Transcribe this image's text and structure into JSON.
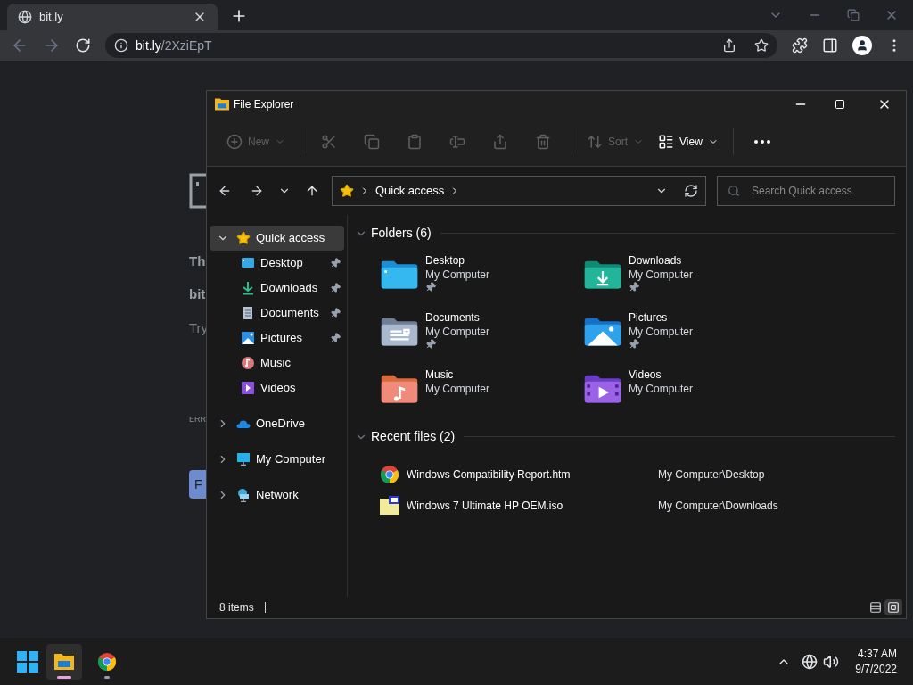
{
  "browser": {
    "tab": {
      "title": "bit.ly"
    },
    "url_host": "bit.ly",
    "url_path": "/2XziEpT"
  },
  "page_behind": {
    "heading": "Th",
    "host": "bit",
    "hint": "Try",
    "error": "ERR",
    "button": "F"
  },
  "explorer": {
    "title": "File Explorer",
    "toolbar": [
      {
        "kind": "new",
        "label": "New",
        "disabled": true
      },
      {
        "kind": "cut",
        "disabled": true
      },
      {
        "kind": "copy",
        "disabled": true
      },
      {
        "kind": "paste",
        "disabled": true
      },
      {
        "kind": "rename",
        "disabled": true
      },
      {
        "kind": "share",
        "disabled": true
      },
      {
        "kind": "delete",
        "disabled": true
      },
      {
        "kind": "sort",
        "label": "Sort",
        "disabled": true
      },
      {
        "kind": "view",
        "label": "View",
        "disabled": false
      },
      {
        "kind": "more",
        "disabled": false
      }
    ],
    "breadcrumb": "Quick access",
    "search": {
      "placeholder": "Search Quick access"
    },
    "nav": [
      {
        "kind": "star",
        "label": "Quick access",
        "selected": true,
        "expanded": true,
        "children": [
          {
            "kind": "desktop",
            "label": "Desktop",
            "pinned": true
          },
          {
            "kind": "downloads",
            "label": "Downloads",
            "pinned": true
          },
          {
            "kind": "documents",
            "label": "Documents",
            "pinned": true
          },
          {
            "kind": "pictures",
            "label": "Pictures",
            "pinned": true
          },
          {
            "kind": "music",
            "label": "Music",
            "pinned": false
          },
          {
            "kind": "videos",
            "label": "Videos",
            "pinned": false
          }
        ]
      },
      {
        "kind": "cloud",
        "label": "OneDrive",
        "selected": false,
        "expanded": false
      },
      {
        "kind": "computer",
        "label": "My Computer",
        "selected": false,
        "expanded": false
      },
      {
        "kind": "network",
        "label": "Network",
        "selected": false,
        "expanded": false
      }
    ],
    "folders_heading": "Folders (6)",
    "folders": [
      {
        "kind": "desktop",
        "name": "Desktop",
        "location": "My Computer",
        "pinned": true
      },
      {
        "kind": "downloads",
        "name": "Downloads",
        "location": "My Computer",
        "pinned": true
      },
      {
        "kind": "documents",
        "name": "Documents",
        "location": "My Computer",
        "pinned": true
      },
      {
        "kind": "pictures",
        "name": "Pictures",
        "location": "My Computer",
        "pinned": true
      },
      {
        "kind": "music",
        "name": "Music",
        "location": "My Computer",
        "pinned": false
      },
      {
        "kind": "videos",
        "name": "Videos",
        "location": "My Computer",
        "pinned": false
      }
    ],
    "recent_heading": "Recent files (2)",
    "recent": [
      {
        "kind": "web",
        "name": "Windows Compatibility Report.htm",
        "location": "My Computer\\Desktop"
      },
      {
        "kind": "disc",
        "name": "Windows 7 Ultimate HP OEM.iso",
        "location": "My Computer\\Downloads"
      }
    ],
    "status": "8 items",
    "views": [
      {
        "kind": "details",
        "selected": false
      },
      {
        "kind": "tiles",
        "selected": true
      }
    ]
  },
  "taskbar": {
    "apps": [
      {
        "kind": "explorer",
        "active": true
      },
      {
        "kind": "chrome",
        "active": false
      }
    ],
    "time": "4:37 AM",
    "date": "9/7/2022"
  }
}
